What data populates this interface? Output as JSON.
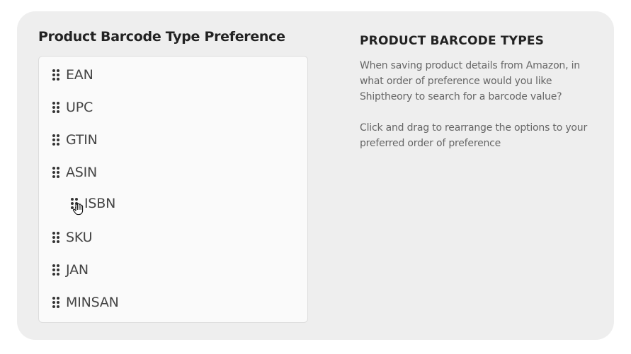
{
  "left": {
    "title_bold": "Product Barcode",
    "title_rest": "Type Preference"
  },
  "barcode_list": {
    "items": [
      {
        "label": "EAN",
        "dragging": false
      },
      {
        "label": "UPC",
        "dragging": false
      },
      {
        "label": "GTIN",
        "dragging": false
      },
      {
        "label": "ASIN",
        "dragging": false
      },
      {
        "label": "ISBN",
        "dragging": true
      },
      {
        "label": "SKU",
        "dragging": false
      },
      {
        "label": "JAN",
        "dragging": false
      },
      {
        "label": "MINSAN",
        "dragging": false
      }
    ]
  },
  "info": {
    "title": "PRODUCT BARCODE TYPES",
    "paragraph_1": "When saving product details from Amazon, in what order of preference would you like Shiptheory to search for a barcode value?",
    "paragraph_2": "Click and drag to rearrange the options to your preferred order of preference"
  },
  "icons": {
    "grip": "drag-handle-icon",
    "cursor": "grab-hand-cursor-icon"
  },
  "colors": {
    "panel_bg": "#eeeeee",
    "list_bg": "#fafafa",
    "grip": "#333333"
  }
}
